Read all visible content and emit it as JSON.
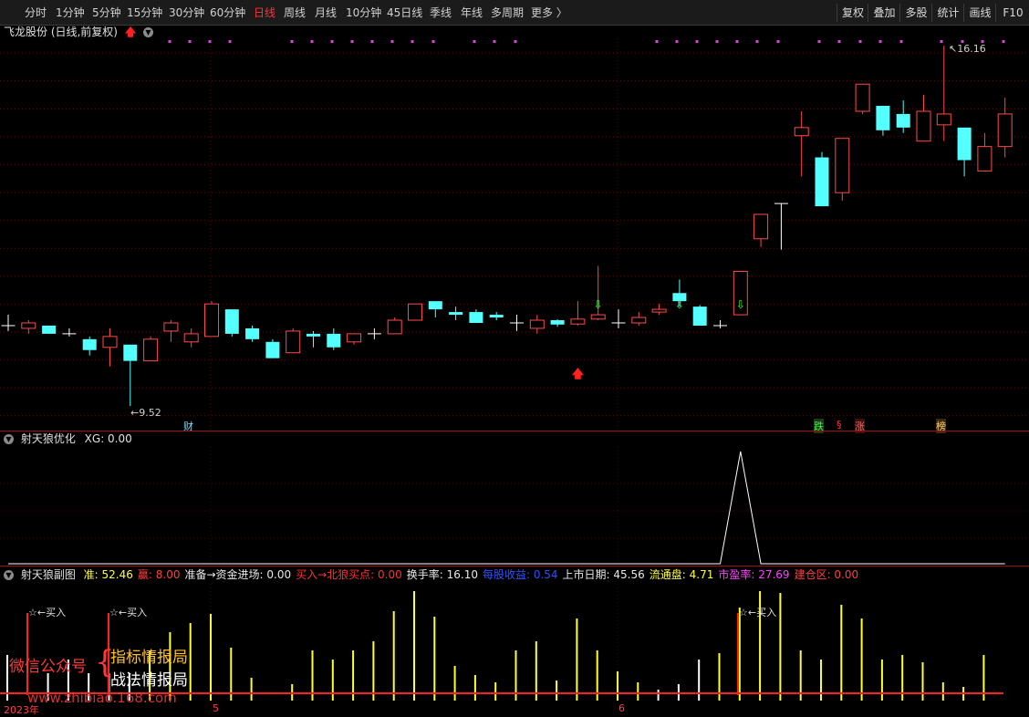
{
  "toolbar": {
    "periods": [
      "分时",
      "1分钟",
      "5分钟",
      "15分钟",
      "30分钟",
      "60分钟",
      "日线",
      "周线",
      "月线",
      "10分钟",
      "45日线",
      "季线",
      "年线",
      "多周期",
      "更多 〉"
    ],
    "active_period": "日线",
    "buttons": [
      "复权",
      "叠加",
      "多股",
      "统计",
      "画线",
      "F10"
    ]
  },
  "main_chart": {
    "title": "飞龙股份 (日线,前复权)",
    "high_label": "16.16",
    "low_label": "9.52",
    "event_labels": [
      "财",
      "跌",
      "§",
      "涨",
      "榜"
    ],
    "colors": {
      "up": "#ff4a4a",
      "down": "#54ffff",
      "doji": "#ffffff"
    }
  },
  "xg_panel": {
    "title": "射天狼优化",
    "value_text": "XG: 0.00"
  },
  "sub_panel": {
    "title": "射天狼副图",
    "items": [
      {
        "label": "准: ",
        "value": "52.46",
        "color": "#ffff40"
      },
      {
        "label": "赢: ",
        "value": "8.00",
        "color": "#ff4040"
      },
      {
        "label": "准备→资金进场: ",
        "value": "0.00",
        "color": "#e8e8e8"
      },
      {
        "label": "买入→北狼买点: ",
        "value": "0.00",
        "color": "#ff3030"
      },
      {
        "label": "换手率: ",
        "value": "16.10",
        "color": "#e8e8e8"
      },
      {
        "label": "每股收益: ",
        "value": "0.54",
        "color": "#3050ff"
      },
      {
        "label": "上市日期: ",
        "value": "45.56",
        "color": "#e8e8e8"
      },
      {
        "label": "流通盘: ",
        "value": "4.71",
        "color": "#ffff40"
      },
      {
        "label": "市盈率: ",
        "value": "27.69",
        "color": "#ff40ff"
      },
      {
        "label": "建仓区: ",
        "value": "0.00",
        "color": "#ff4040"
      }
    ],
    "buy_marker": "☆←买入",
    "watermark_left": "微信公众号",
    "watermark_brace": "{",
    "watermark_line1": "指标情报局",
    "watermark_line2": "战法情报局",
    "watermark_url": "www.zhibiao.168.com"
  },
  "axis": {
    "year_label": "2023年",
    "month_labels": [
      "5",
      "6"
    ]
  },
  "candles": [
    {
      "o": 11.0,
      "c": 11.0,
      "h": 11.2,
      "l": 10.9
    },
    {
      "o": 10.95,
      "c": 11.05,
      "h": 11.1,
      "l": 10.85
    },
    {
      "o": 11.0,
      "c": 10.85,
      "h": 11.0,
      "l": 10.85
    },
    {
      "o": 10.85,
      "c": 10.85,
      "h": 10.95,
      "l": 10.8
    },
    {
      "o": 10.75,
      "c": 10.55,
      "h": 10.8,
      "l": 10.45
    },
    {
      "o": 10.6,
      "c": 10.8,
      "h": 10.95,
      "l": 10.25
    },
    {
      "o": 10.65,
      "c": 10.35,
      "h": 10.65,
      "l": 9.52
    },
    {
      "o": 10.35,
      "c": 10.75,
      "h": 10.8,
      "l": 10.35
    },
    {
      "o": 10.9,
      "c": 11.05,
      "h": 11.1,
      "l": 10.7
    },
    {
      "o": 10.7,
      "c": 10.85,
      "h": 10.95,
      "l": 10.6
    },
    {
      "o": 10.8,
      "c": 11.4,
      "h": 11.45,
      "l": 10.8
    },
    {
      "o": 11.3,
      "c": 10.85,
      "h": 11.3,
      "l": 10.8
    },
    {
      "o": 10.95,
      "c": 10.75,
      "h": 11.0,
      "l": 10.7
    },
    {
      "o": 10.7,
      "c": 10.4,
      "h": 10.75,
      "l": 10.4
    },
    {
      "o": 10.5,
      "c": 10.9,
      "h": 10.95,
      "l": 10.5
    },
    {
      "o": 10.85,
      "c": 10.8,
      "h": 10.9,
      "l": 10.6
    },
    {
      "o": 10.85,
      "c": 10.6,
      "h": 10.95,
      "l": 10.55
    },
    {
      "o": 10.7,
      "c": 10.85,
      "h": 10.85,
      "l": 10.65
    },
    {
      "o": 10.85,
      "c": 10.85,
      "h": 10.95,
      "l": 10.75
    },
    {
      "o": 10.85,
      "c": 11.1,
      "h": 11.15,
      "l": 10.85
    },
    {
      "o": 11.1,
      "c": 11.4,
      "h": 11.4,
      "l": 11.1
    },
    {
      "o": 11.45,
      "c": 11.3,
      "h": 11.45,
      "l": 11.15
    },
    {
      "o": 11.25,
      "c": 11.2,
      "h": 11.35,
      "l": 11.1
    },
    {
      "o": 11.25,
      "c": 11.05,
      "h": 11.3,
      "l": 11.05
    },
    {
      "o": 11.2,
      "c": 11.15,
      "h": 11.25,
      "l": 11.1
    },
    {
      "o": 11.05,
      "c": 11.05,
      "h": 11.2,
      "l": 10.9
    },
    {
      "o": 10.95,
      "c": 11.1,
      "h": 11.2,
      "l": 10.85
    },
    {
      "o": 11.1,
      "c": 11.02,
      "h": 11.12,
      "l": 10.98
    },
    {
      "o": 11.03,
      "c": 11.12,
      "h": 11.45,
      "l": 11.0
    },
    {
      "o": 11.12,
      "c": 11.2,
      "h": 12.1,
      "l": 11.1
    },
    {
      "o": 11.05,
      "c": 11.05,
      "h": 11.3,
      "l": 10.95
    },
    {
      "o": 11.05,
      "c": 11.15,
      "h": 11.25,
      "l": 11.0
    },
    {
      "o": 11.25,
      "c": 11.3,
      "h": 11.4,
      "l": 11.2
    },
    {
      "o": 11.6,
      "c": 11.45,
      "h": 11.85,
      "l": 11.35
    },
    {
      "o": 11.35,
      "c": 11.0,
      "h": 11.38,
      "l": 11.0
    },
    {
      "o": 11.0,
      "c": 11.0,
      "h": 11.1,
      "l": 10.95
    },
    {
      "o": 11.2,
      "c": 12.0,
      "h": 12.0,
      "l": 11.2
    },
    {
      "o": 12.6,
      "c": 13.05,
      "h": 13.05,
      "l": 12.45
    },
    {
      "o": 13.25,
      "c": 13.25,
      "h": 13.25,
      "l": 12.4
    },
    {
      "o": 14.5,
      "c": 14.65,
      "h": 14.95,
      "l": 13.75
    },
    {
      "o": 14.1,
      "c": 13.2,
      "h": 14.2,
      "l": 13.2
    },
    {
      "o": 13.45,
      "c": 14.45,
      "h": 14.45,
      "l": 13.3
    },
    {
      "o": 14.95,
      "c": 15.45,
      "h": 15.45,
      "l": 14.9
    },
    {
      "o": 15.05,
      "c": 14.6,
      "h": 15.05,
      "l": 14.5
    },
    {
      "o": 14.9,
      "c": 14.65,
      "h": 15.15,
      "l": 14.55
    },
    {
      "o": 14.4,
      "c": 14.95,
      "h": 15.25,
      "l": 14.4
    },
    {
      "o": 14.7,
      "c": 14.9,
      "h": 16.16,
      "l": 14.4
    },
    {
      "o": 14.65,
      "c": 14.05,
      "h": 14.65,
      "l": 13.75
    },
    {
      "o": 13.85,
      "c": 14.3,
      "h": 14.55,
      "l": 13.85
    },
    {
      "o": 14.3,
      "c": 14.9,
      "h": 15.2,
      "l": 14.1
    }
  ],
  "xg_values": [
    0,
    0,
    0,
    0,
    0,
    0,
    0,
    0,
    0,
    0,
    0,
    0,
    0,
    0,
    0,
    0,
    0,
    0,
    0,
    0,
    0,
    0,
    0,
    0,
    0,
    0,
    0,
    0,
    0,
    0,
    0,
    0,
    0,
    0,
    0,
    0,
    1,
    0,
    0,
    0,
    0,
    0,
    0,
    0,
    0,
    0,
    0,
    0,
    0,
    0
  ],
  "sub_bars": [
    {
      "v": 0.5,
      "c": "w"
    },
    {
      "v": 0.0,
      "c": "w"
    },
    {
      "v": 0.3,
      "c": "w"
    },
    {
      "v": 0.45,
      "c": "w"
    },
    {
      "v": 0.3,
      "c": "w"
    },
    {
      "v": 0.3,
      "c": "w"
    },
    {
      "v": 0.3,
      "c": "w"
    },
    {
      "v": 0.55,
      "c": "y"
    },
    {
      "v": 0.75,
      "c": "y"
    },
    {
      "v": 0.85,
      "c": "y"
    },
    {
      "v": 0.95,
      "c": "y"
    },
    {
      "v": 0.58,
      "c": "y"
    },
    {
      "v": 0.25,
      "c": "y"
    },
    {
      "v": 0.0,
      "c": "w"
    },
    {
      "v": 0.18,
      "c": "y"
    },
    {
      "v": 0.55,
      "c": "y"
    },
    {
      "v": 0.45,
      "c": "y"
    },
    {
      "v": 0.55,
      "c": "y"
    },
    {
      "v": 0.65,
      "c": "y"
    },
    {
      "v": 0.98,
      "c": "y"
    },
    {
      "v": 1.2,
      "c": "y"
    },
    {
      "v": 0.92,
      "c": "y"
    },
    {
      "v": 0.38,
      "c": "y"
    },
    {
      "v": 0.28,
      "c": "y"
    },
    {
      "v": 0.2,
      "c": "y"
    },
    {
      "v": 0.55,
      "c": "y"
    },
    {
      "v": 0.65,
      "c": "y"
    },
    {
      "v": 0.22,
      "c": "y"
    },
    {
      "v": 0.9,
      "c": "y"
    },
    {
      "v": 0.55,
      "c": "y"
    },
    {
      "v": 0.32,
      "c": "y"
    },
    {
      "v": 0.2,
      "c": "y"
    },
    {
      "v": 0.12,
      "c": "w"
    },
    {
      "v": 0.18,
      "c": "w"
    },
    {
      "v": 0.45,
      "c": "w"
    },
    {
      "v": 0.52,
      "c": "y"
    },
    {
      "v": 1.02,
      "c": "y"
    },
    {
      "v": 1.2,
      "c": "y"
    },
    {
      "v": 1.18,
      "c": "y"
    },
    {
      "v": 0.55,
      "c": "y"
    },
    {
      "v": 0.45,
      "c": "y"
    },
    {
      "v": 1.05,
      "c": "y"
    },
    {
      "v": 0.9,
      "c": "y"
    },
    {
      "v": 0.45,
      "c": "y"
    },
    {
      "v": 0.5,
      "c": "y"
    },
    {
      "v": 0.42,
      "c": "y"
    },
    {
      "v": 0.2,
      "c": "y"
    },
    {
      "v": 0.15,
      "c": "y"
    },
    {
      "v": 0.5,
      "c": "y"
    }
  ]
}
